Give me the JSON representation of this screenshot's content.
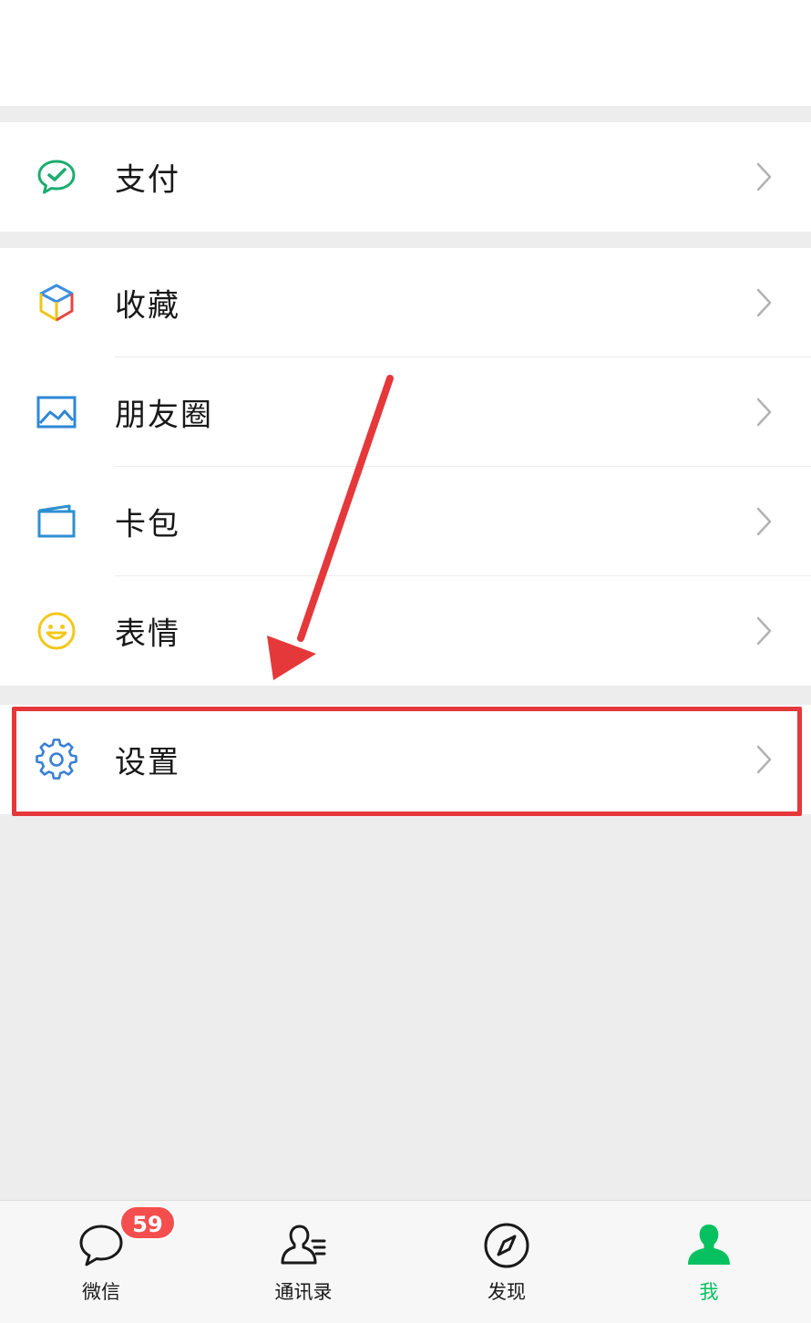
{
  "menu": {
    "pay": {
      "label": "支付",
      "icon": "pay-icon"
    },
    "favorites": {
      "label": "收藏",
      "icon": "cube-icon"
    },
    "moments": {
      "label": "朋友圈",
      "icon": "image-icon"
    },
    "cards": {
      "label": "卡包",
      "icon": "card-wallet-icon"
    },
    "stickers": {
      "label": "表情",
      "icon": "smiley-icon"
    },
    "settings": {
      "label": "设置",
      "icon": "gear-icon"
    }
  },
  "tabbar": {
    "chats": {
      "label": "微信",
      "icon": "chat-bubble-icon",
      "badge": "59"
    },
    "contacts": {
      "label": "通讯录",
      "icon": "contacts-icon"
    },
    "discover": {
      "label": "发现",
      "icon": "compass-icon"
    },
    "me": {
      "label": "我",
      "icon": "person-icon",
      "active": true
    }
  },
  "colors": {
    "accent": "#07c160",
    "badge": "#f54e4e",
    "annotation": "#e5383b",
    "background": "#ededed"
  }
}
